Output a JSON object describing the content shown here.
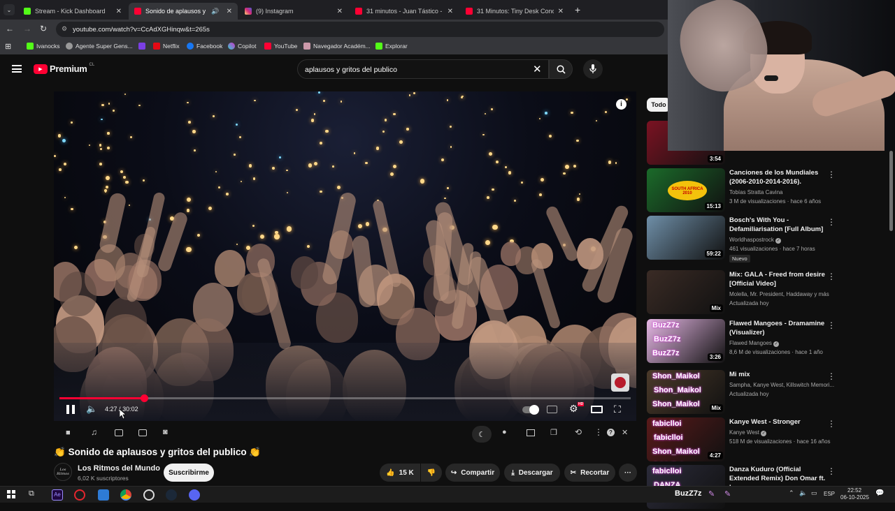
{
  "browser": {
    "tabs": [
      {
        "label": "Stream - Kick Dashboard",
        "active": false
      },
      {
        "label": "Sonido de aplausos y gr",
        "active": true
      },
      {
        "label": "(9) Instagram",
        "active": false
      },
      {
        "label": "31 minutos - Juan Tástico - Rin",
        "active": false
      },
      {
        "label": "31 Minutos: Tiny Desk Concert",
        "active": false
      }
    ],
    "new_tab": "+",
    "url": "youtube.com/watch?v=CcAdXGHinqw&t=265s",
    "bookmarks": [
      "Ivanocks",
      "Agente Super Gens...",
      "Netflix",
      "Facebook",
      "Copilot",
      "YouTube",
      "Navegador Académ...",
      "Explorar"
    ]
  },
  "youtube": {
    "logo_text": "Premium",
    "region": "CL",
    "search_query": "aplausos y gritos del publico",
    "filter_chip": "Todo"
  },
  "player": {
    "current_time": "4:27",
    "separator": "/",
    "duration": "30:02",
    "progress_fraction": 0.148,
    "hd_badge": "HD"
  },
  "video": {
    "title_emoji_left": "👏",
    "title": "Sonido de aplausos y gritos del publico",
    "title_emoji_right": "👏",
    "channel": "Los Ritmos del Mundo",
    "channel_logo_text": "Los Ritmos",
    "subscribers": "6,02 K suscriptores",
    "subscribe": "Suscribirme",
    "likes": "15 K",
    "share": "Compartir",
    "download": "Descargar",
    "clip": "Recortar",
    "more": "···"
  },
  "sidebar": [
    {
      "title": "",
      "channel": "",
      "meta": "",
      "duration": "3:54",
      "thumb_color": "#7a1222"
    },
    {
      "title": "Canciones de los Mundiales (2006-2010-2014-2016).",
      "channel": "Tobías Stratta Cavina",
      "meta": "3 M de visualizaciones · hace 6 años",
      "duration": "15:13",
      "thumb_color": "#1b6b2a",
      "thumb_text": "SOUTH AFRICA 2010"
    },
    {
      "title": "Bosch's With You - Defamiliarisation [Full Album]",
      "channel": "Worldhaspostrock",
      "verified": true,
      "meta": "461 visualizaciones · hace 7 horas",
      "badge": "Nuevo",
      "duration": "59:22",
      "thumb_color": "#6f8fa8"
    },
    {
      "title": "Mix: GALA - Freed from desire [Official Video]",
      "channel": "Molella, Mr. President, Haddaway y más",
      "meta": "Actualizada hoy",
      "duration": "Mix",
      "thumb_color": "#3a2b25"
    },
    {
      "title": "Flawed Mangoes - Dramamine (Visualizer)",
      "channel": "Flawed Mangoes",
      "verified": true,
      "meta": "8,6 M de visualizaciones · hace 1 año",
      "duration": "3:26",
      "thumb_color": "#e7b8e6",
      "overlay": [
        "BuzZ7z",
        "BuzZ7z",
        "BuzZ7z"
      ]
    },
    {
      "title": "Mi mix",
      "channel": "Sampha, Kanye West, Killswitch Memori...",
      "meta": "Actualizada hoy",
      "duration": "Mix",
      "thumb_color": "#4b3a2a",
      "overlay": [
        "Shon_Maikol",
        "Shon_Maikol",
        "Shon_Maikol"
      ]
    },
    {
      "title": "Kanye West - Stronger",
      "channel": "Kanye West",
      "verified": true,
      "meta": "518 M de visualizaciones · hace 16 años",
      "duration": "4:27",
      "thumb_color": "#5a1a1a",
      "overlay": [
        "fabiclloi",
        "fabiclloi",
        "Shon_Maikol",
        "fabiclloi"
      ]
    },
    {
      "title": "Danza Kuduro (Official Extended Remix) Don Omar ft. Lucenzo, ...",
      "channel": "",
      "meta": "",
      "duration": "",
      "thumb_color": "#2b2b3a",
      "overlay": [
        "fabiclloi",
        "DANZA"
      ]
    }
  ],
  "taskbar": {
    "stream_name": "BuzZ7z",
    "language": "ESP",
    "time": "22:52",
    "date": "06-10-2025"
  },
  "colors": {
    "accent": "#ff0033",
    "bg": "#0f0f0f",
    "chip": "#272727"
  }
}
